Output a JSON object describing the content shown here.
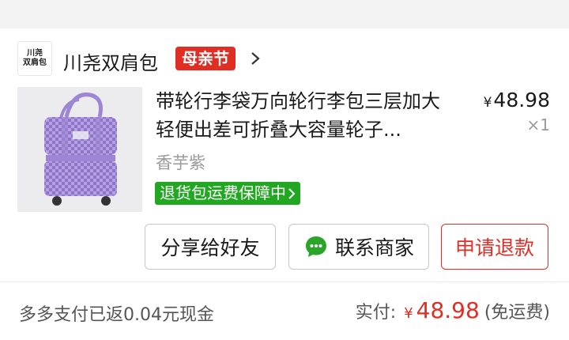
{
  "shop": {
    "logo_line1": "川尧",
    "logo_line2": "双肩包",
    "name": "川尧双肩包",
    "festival_badge": "母亲节"
  },
  "product": {
    "title": "带轮行李袋万向轮行李包三层加大轻便出差可折叠大容量轮子...",
    "price_symbol": "¥",
    "price": "48.98",
    "quantity": "×1",
    "variant": "香芋紫",
    "return_badge": "退货包运费保障中"
  },
  "actions": {
    "share": "分享给好友",
    "contact": "联系商家",
    "refund": "申请退款"
  },
  "summary": {
    "cashback": "多多支付已返0.04元现金",
    "paid_label": "实付:",
    "paid_symbol": "¥",
    "paid_amount": "48.98",
    "shipping": "(免运费)"
  },
  "colors": {
    "accent_red": "#e02e24",
    "badge_green": "#22a722",
    "product_purple": "#a48ad6"
  },
  "icons": [
    "chevron-right-icon",
    "chat-bubble-icon",
    "chevron-right-small-icon"
  ]
}
